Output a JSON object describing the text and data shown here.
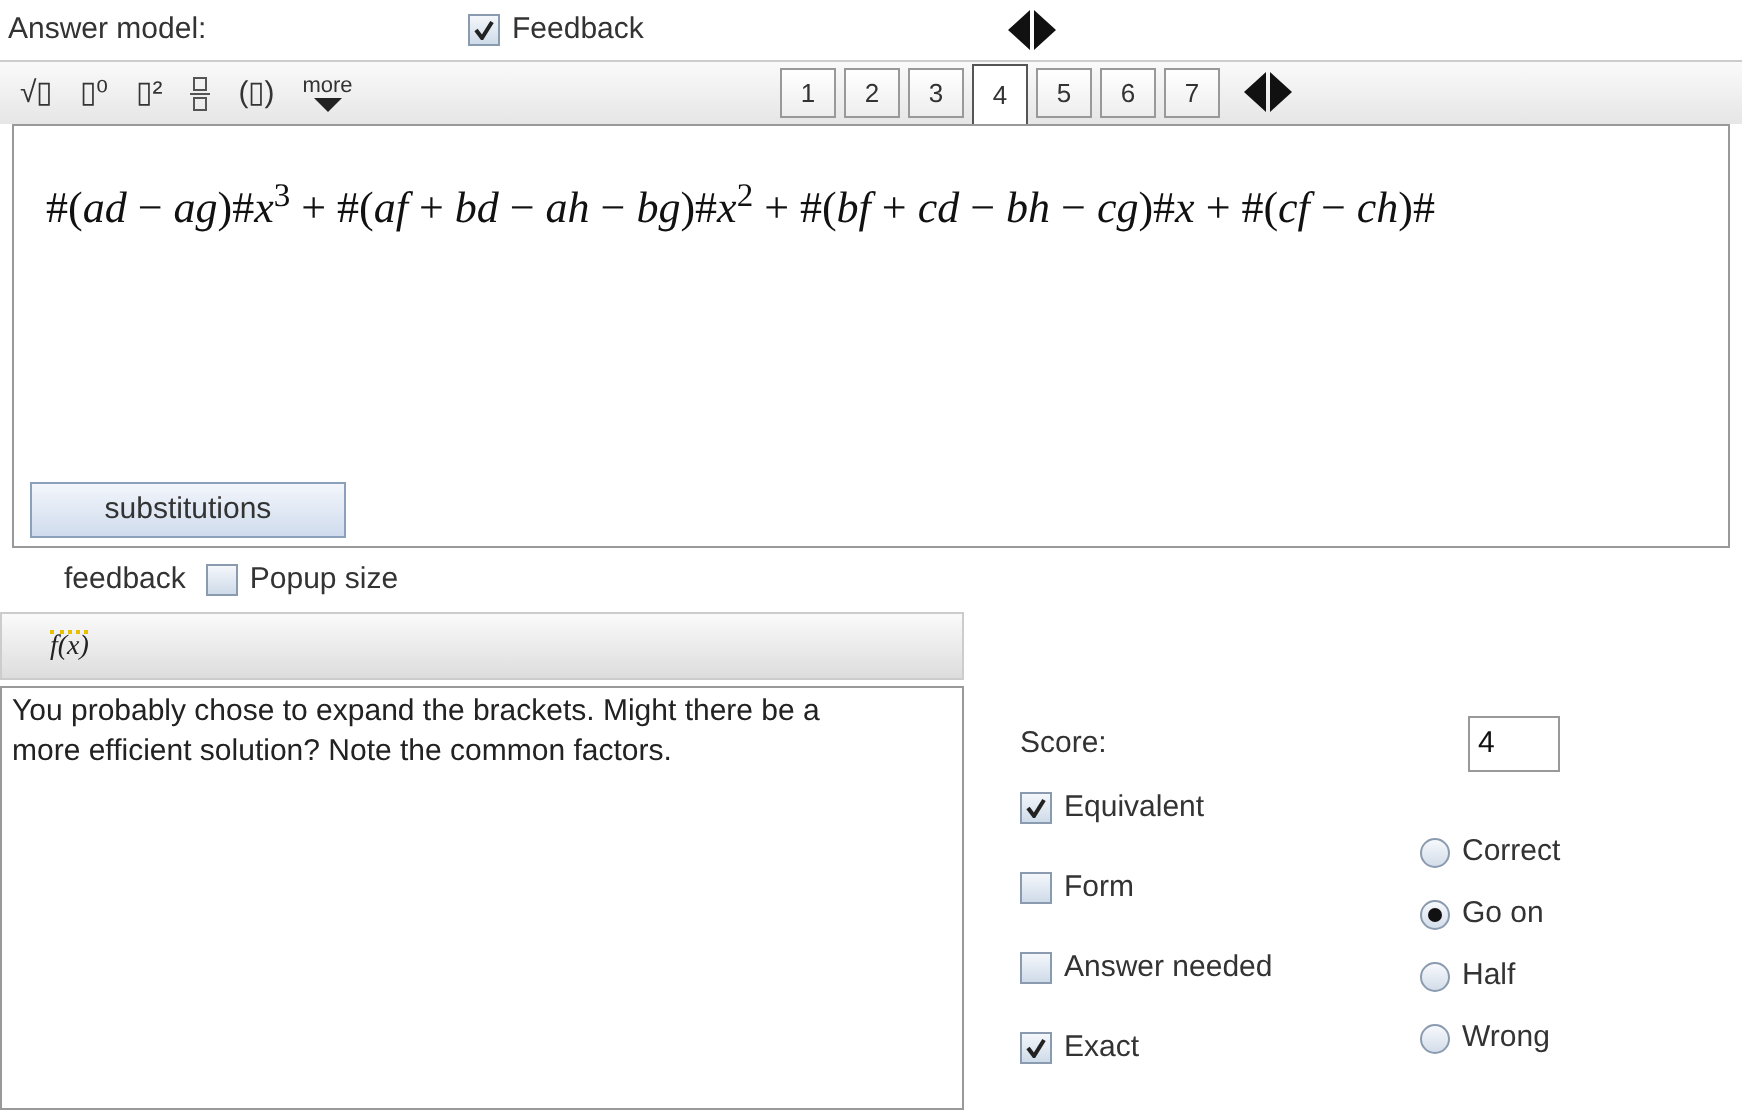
{
  "header": {
    "label": "Answer model:",
    "feedback_toggle": {
      "label": "Feedback",
      "checked": true
    }
  },
  "toolbar": [
    {
      "kind": "text",
      "label": "√▯"
    },
    {
      "kind": "text",
      "label": "▯⁰"
    },
    {
      "kind": "text",
      "label": "▯²"
    },
    {
      "kind": "fraction"
    },
    {
      "kind": "text",
      "label": "(▯)"
    },
    {
      "kind": "more",
      "label": "more"
    }
  ],
  "tabs": [
    {
      "label": "1",
      "selected": false
    },
    {
      "label": "2",
      "selected": false
    },
    {
      "label": "3",
      "selected": false
    },
    {
      "label": "4",
      "selected": true
    },
    {
      "label": "5",
      "selected": false
    },
    {
      "label": "6",
      "selected": false
    },
    {
      "label": "7",
      "selected": false
    }
  ],
  "formula": "#(*ad* − *ag*)#*x*$^{3}$ + #(*af* + *bd* − *ah* − *bg*)#*x*$^{2}$ + #(*bf* + *cd* − *bh* − *cg*)#*x* + #(*cf* − *ch*)#",
  "substitutions_button": "substitutions",
  "function_button": "f(x)",
  "feedback": {
    "label": "feedback",
    "popup_size": {
      "label": "Popup size",
      "checked": false
    },
    "text": "You probably chose to expand the brackets. Might there be a more efficient solution? Note the common factors."
  },
  "score": {
    "label": "Score:",
    "value": "4"
  },
  "checks": [
    {
      "label": "Equivalent",
      "checked": true
    },
    {
      "label": "Form",
      "checked": false
    },
    {
      "label": "Answer needed",
      "checked": false
    },
    {
      "label": "Exact",
      "checked": true
    }
  ],
  "outcomes": [
    {
      "label": "Correct",
      "selected": false
    },
    {
      "label": "Go on",
      "selected": true
    },
    {
      "label": "Half",
      "selected": false
    },
    {
      "label": "Wrong",
      "selected": false
    }
  ]
}
